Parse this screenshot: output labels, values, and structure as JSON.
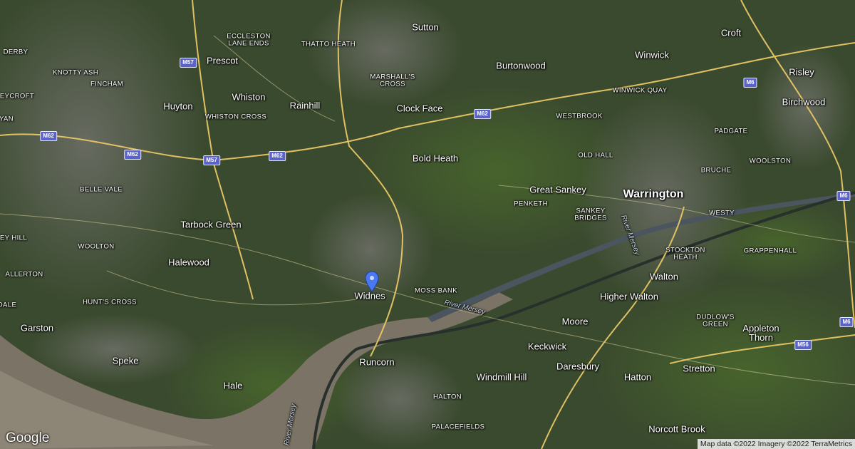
{
  "map": {
    "logo": "Google",
    "attribution": "Map data ©2022 Imagery ©2022 TerraMetrics",
    "marker": {
      "label": "Widnes",
      "icon": "map-pin-icon",
      "color": "#4a78f0"
    },
    "places": {
      "sutton": "Sutton",
      "croft": "Croft",
      "eccleston_lane_ends": "ECCLESTON LANE ENDS",
      "thatto_heath": "THATTO HEATH",
      "winwick": "Winwick",
      "risley": "Risley",
      "derby": "DERBY",
      "knotty_ash": "KNOTTY ASH",
      "prescot": "Prescot",
      "burtonwood": "Burtonwood",
      "marshalls_cross": "MARSHALL'S CROSS",
      "fincham": "FINCHAM",
      "eycroft": "EYCROFT",
      "winwick_quay": "WINWICK QUAY",
      "whiston": "Whiston",
      "birchwood": "Birchwood",
      "huyton": "Huyton",
      "rainhill": "Rainhill",
      "clock_face": "Clock Face",
      "whiston_cross": "WHISTON CROSS",
      "westbrook": "WESTBROOK",
      "padgate": "PADGATE",
      "yan": "YAN",
      "old_hall": "OLD HALL",
      "bold_heath": "Bold Heath",
      "woolston": "WOOLSTON",
      "bruche": "BRUCHE",
      "belle_vale": "BELLE VALE",
      "great_sankey": "Great Sankey",
      "warrington": "Warrington",
      "penketh": "PENKETH",
      "westy": "WESTY",
      "sankey_bridges": "SANKEY BRIDGES",
      "tarbock_green": "Tarbock Green",
      "ey_hill": "EY HILL",
      "woolton": "WOOLTON",
      "stockton_heath": "STOCKTON HEATH",
      "grappenhall": "GRAPPENHALL",
      "halewood": "Halewood",
      "allerton": "ALLERTON",
      "walton": "Walton",
      "moss_bank": "MOSS BANK",
      "higher_walton": "Higher Walton",
      "huns_cross": "HUNT'S CROSS",
      "dale": "DALE",
      "dudlows_green": "DUDLOW'S GREEN",
      "moore": "Moore",
      "garston": "Garston",
      "appleton_thorn": "Appleton Thorn",
      "keckwick": "Keckwick",
      "speke": "Speke",
      "runcorn": "Runcorn",
      "windmill_hill": "Windmill Hill",
      "daresbury": "Daresbury",
      "hatton": "Hatton",
      "stretton": "Stretton",
      "hale": "Hale",
      "halton": "HALTON",
      "palacefields": "PALACEFIELDS",
      "norcott_brook": "Norcott Brook"
    },
    "water": {
      "river_mersey_east": "River Mersey",
      "river_mersey_west": "River Mersey",
      "river_mersey_north": "River Mersey"
    },
    "roads": {
      "m57_north": "M57",
      "m57_south": "M57",
      "m62_west": "M62",
      "m62_mid": "M62",
      "m62_center": "M62",
      "m62_east": "M62",
      "m6_north": "M6",
      "m6_mid": "M6",
      "m6_south": "M6",
      "m56": "M56"
    },
    "colors": {
      "motorway": "#e8c766",
      "water": "#8a7f6c",
      "land": "#3d4a2f"
    }
  }
}
